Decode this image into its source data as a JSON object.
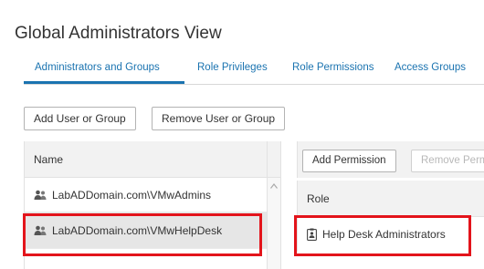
{
  "page": {
    "title": "Global Administrators View"
  },
  "tabs": [
    {
      "label": "Administrators and Groups",
      "active": true
    },
    {
      "label": "Role Privileges"
    },
    {
      "label": "Role Permissions"
    },
    {
      "label": "Access Groups"
    }
  ],
  "toolbar": {
    "add_user_label": "Add User or Group",
    "remove_user_label": "Remove User or Group"
  },
  "admins_table": {
    "header": "Name",
    "rows": [
      {
        "name": "LabADDomain.com\\VMwAdmins"
      },
      {
        "name": "LabADDomain.com\\VMwHelpDesk",
        "selected": true
      }
    ]
  },
  "permissions": {
    "add_label": "Add Permission",
    "remove_label": "Remove Permission",
    "header": "Role",
    "rows": [
      {
        "role": "Help Desk Administrators"
      }
    ]
  },
  "colors": {
    "accent": "#1a73b0",
    "highlight": "#e3141b"
  }
}
